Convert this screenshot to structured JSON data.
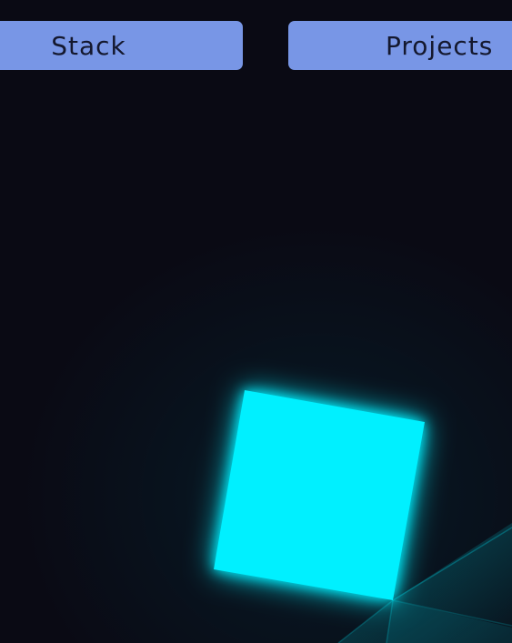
{
  "nav": {
    "stack_label": "Stack",
    "projects_label": "Projects"
  },
  "colors": {
    "background": "#0a0a14",
    "button": "#7896e6",
    "button_text": "#14182e",
    "cube": "#00f0ff"
  }
}
